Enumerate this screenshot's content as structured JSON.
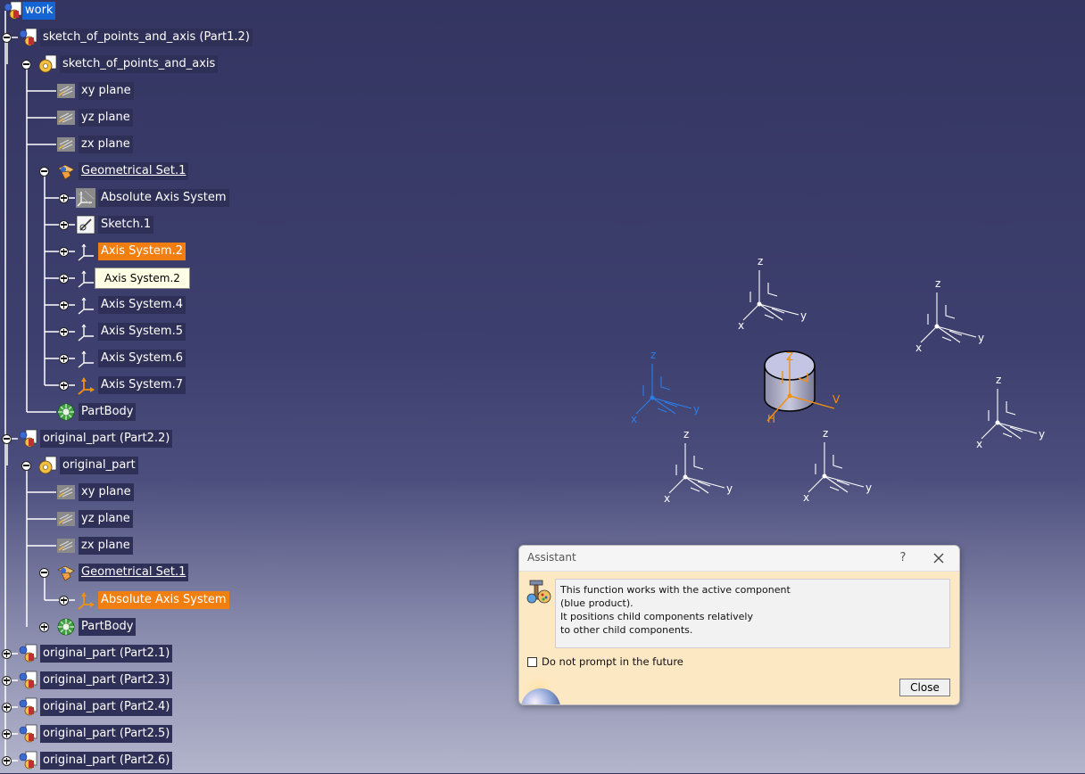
{
  "tree": {
    "items": [
      {
        "label": "work",
        "kind": "root",
        "state": "selected"
      },
      {
        "label": "sketch_of_points_and_axis (Part1.2)",
        "kind": "product",
        "toggle": "minus"
      },
      {
        "label": "sketch_of_points_and_axis",
        "kind": "part",
        "toggle": "minus"
      },
      {
        "label": "xy plane",
        "kind": "plane"
      },
      {
        "label": "yz plane",
        "kind": "plane"
      },
      {
        "label": "zx plane",
        "kind": "plane"
      },
      {
        "label": "Geometrical Set.1",
        "kind": "geoset",
        "toggle": "minus",
        "underline": true
      },
      {
        "label": "Absolute Axis System",
        "kind": "axis-abs",
        "toggle": "plus"
      },
      {
        "label": "Sketch.1",
        "kind": "sketch",
        "toggle": "plus"
      },
      {
        "label": "Axis System.2",
        "kind": "axis",
        "toggle": "plus",
        "state": "highlighted"
      },
      {
        "label": "",
        "kind": "axis",
        "toggle": "plus"
      },
      {
        "label": "Axis System.4",
        "kind": "axis",
        "toggle": "plus"
      },
      {
        "label": "Axis System.5",
        "kind": "axis",
        "toggle": "plus"
      },
      {
        "label": "Axis System.6",
        "kind": "axis",
        "toggle": "plus"
      },
      {
        "label": "Axis System.7",
        "kind": "axis-orange",
        "toggle": "plus"
      },
      {
        "label": "PartBody",
        "kind": "body"
      },
      {
        "label": "original_part (Part2.2)",
        "kind": "product",
        "toggle": "minus"
      },
      {
        "label": "original_part",
        "kind": "part",
        "toggle": "minus"
      },
      {
        "label": "xy plane",
        "kind": "plane"
      },
      {
        "label": "yz plane",
        "kind": "plane"
      },
      {
        "label": "zx plane",
        "kind": "plane"
      },
      {
        "label": "Geometrical Set.1",
        "kind": "geoset",
        "toggle": "minus",
        "underline": true
      },
      {
        "label": "Absolute Axis System",
        "kind": "axis-orange",
        "toggle": "plus",
        "state": "highlighted"
      },
      {
        "label": "PartBody",
        "kind": "body",
        "toggle": "plus"
      },
      {
        "label": "original_part (Part2.1)",
        "kind": "product",
        "toggle": "plus"
      },
      {
        "label": "original_part (Part2.3)",
        "kind": "product",
        "toggle": "plus"
      },
      {
        "label": "original_part (Part2.4)",
        "kind": "product",
        "toggle": "plus"
      },
      {
        "label": "original_part (Part2.5)",
        "kind": "product",
        "toggle": "plus"
      },
      {
        "label": "original_part (Part2.6)",
        "kind": "product",
        "toggle": "plus"
      }
    ],
    "tooltip": "Axis System.2"
  },
  "viewport": {
    "axis_letters": {
      "x": "x",
      "y": "y",
      "z": "z"
    },
    "part_letters": {
      "z": "Z",
      "v": "V",
      "h": "H"
    }
  },
  "assistant": {
    "title": "Assistant",
    "help_label": "?",
    "message_lines": [
      "This function works with the active component",
      "(blue product).",
      "It positions child components relatively",
      "to other child components."
    ],
    "checkbox_label": "Do not prompt in the future",
    "checkbox_checked": false,
    "close_label": "Close"
  },
  "colors": {
    "selected": "#1464d4",
    "highlight": "#f07e10",
    "label_bg": "#2f3058",
    "dialog_bg": "#fde8c4"
  }
}
